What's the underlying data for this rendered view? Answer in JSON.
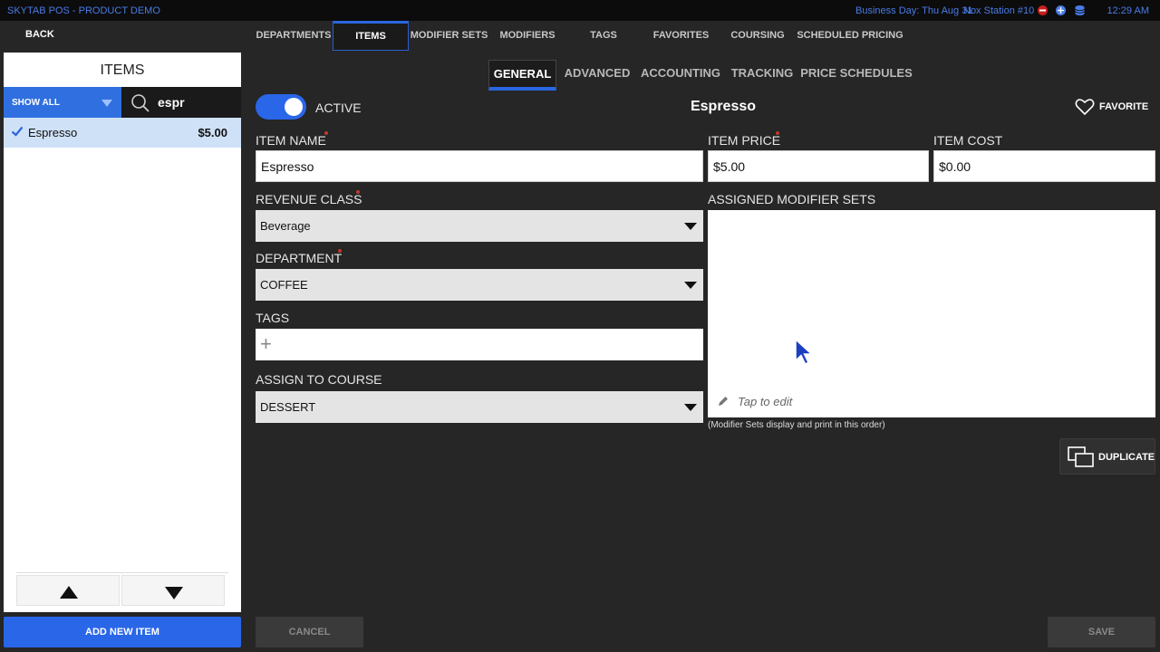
{
  "titlebar": {
    "app": "SKYTAB POS - PRODUCT DEMO",
    "business_day": "Business Day: Thu Aug 31",
    "station": "Nox Station  #10",
    "time": "12:29 AM"
  },
  "nav": {
    "back": "BACK",
    "tabs": [
      "DEPARTMENTS",
      "ITEMS",
      "MODIFIER SETS",
      "MODIFIERS",
      "TAGS",
      "FAVORITES",
      "COURSING",
      "SCHEDULED PRICING"
    ],
    "active_tab": "ITEMS"
  },
  "left_panel": {
    "title": "ITEMS",
    "filter": "SHOW ALL",
    "search_value": "espr",
    "items": [
      {
        "name": "Espresso",
        "price": "$5.00",
        "selected": true
      }
    ],
    "add_new": "ADD NEW ITEM"
  },
  "sub_tabs": {
    "tabs": [
      "GENERAL",
      "ADVANCED",
      "ACCOUNTING",
      "TRACKING",
      "PRICE SCHEDULES"
    ],
    "active": "GENERAL"
  },
  "form": {
    "active_label": "ACTIVE",
    "active": true,
    "item_title": "Espresso",
    "favorite_label": "FAVORITE",
    "item_name_label": "ITEM NAME",
    "item_name": "Espresso",
    "item_price_label": "ITEM PRICE",
    "item_price": "$5.00",
    "item_cost_label": "ITEM COST",
    "item_cost": "$0.00",
    "revenue_class_label": "REVENUE CLASS",
    "revenue_class": "Beverage",
    "department_label": "DEPARTMENT",
    "department": "COFFEE",
    "tags_label": "TAGS",
    "tags_add": "+",
    "course_label": "ASSIGN TO COURSE",
    "course": "DESSERT",
    "modifier_sets_label": "ASSIGNED MODIFIER SETS",
    "tap_to_edit": "Tap to edit",
    "modifier_note": "(Modifier Sets display and print in this order)",
    "duplicate": "DUPLICATE"
  },
  "footer": {
    "cancel": "CANCEL",
    "save": "SAVE"
  },
  "colors": {
    "accent": "#2a66e8",
    "required": "#c0392b",
    "background": "#262626"
  }
}
